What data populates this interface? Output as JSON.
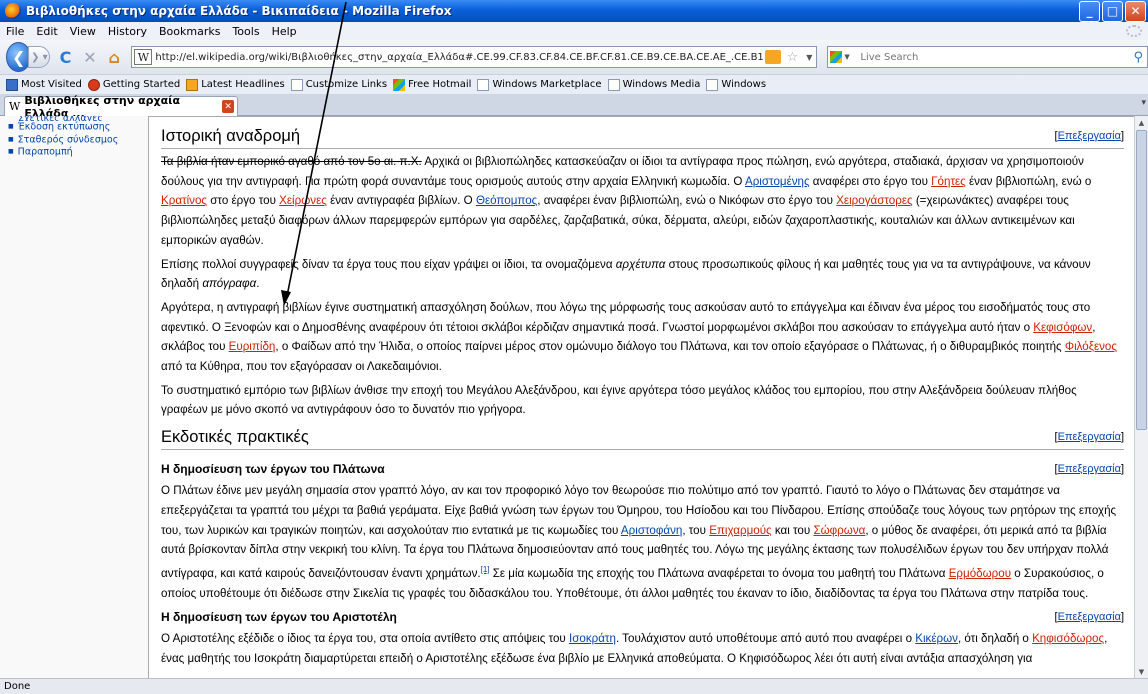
{
  "window": {
    "title": "Βιβλιοθήκες στην αρχαία Ελλάδα - Βικιπαίδεια - Mozilla Firefox",
    "minimize": "_",
    "maximize": "□",
    "close": "✕"
  },
  "menu": [
    "File",
    "Edit",
    "View",
    "History",
    "Bookmarks",
    "Tools",
    "Help"
  ],
  "nav": {
    "url": "http://el.wikipedia.org/wiki/Βιβλιοθήκες_στην_αρχαία_Ελλάδα#.CE.99.CF.83.CF.84.CE.BF.CF.81.CE.B9.CE.BA.CE.AE_.CE.B1.CE.BD.CE.B1.CE.B4.(",
    "search_placeholder": "Live Search",
    "site_icon": "W"
  },
  "bookmarks": [
    "Most Visited",
    "Getting Started",
    "Latest Headlines",
    "Customize Links",
    "Free Hotmail",
    "Windows Marketplace",
    "Windows Media",
    "Windows"
  ],
  "tab": {
    "label": "Βιβλιοθήκες στην αρχαία Ελλάδα ...",
    "icon": "W"
  },
  "sidebar": {
    "cut_item": "Σχετικές αλλαγές",
    "items": [
      "Έκδοση εκτύπωσης",
      "Σταθερός σύνδεσμος",
      "Παραπομπή"
    ]
  },
  "article": {
    "edit_label": "Επεξεργασία",
    "h_history": "Ιστορική αναδρομή",
    "h_publishing": "Εκδοτικές πρακτικές",
    "h_plato": "Η δημοσίευση των έργων του Πλάτωνα",
    "h_aristotle": "Η δημοσίευση των έργων του Αριστοτέλη",
    "p1": {
      "s0": "Τα βιβλία ήταν εμπορικό αγαθό από τον 5ο αι. π.Χ.",
      "s1": " Αρχικά οι βιβλιοπώληδες κατασκεύαζαν οι ίδιοι τα αντίγραφα προς πώληση, ενώ αργότερα, σταδιακά, άρχισαν να χρησιμοποιούν δούλους για την αντιγραφή. Για πρώτη φορά συναντάμε τους ορισμούς αυτούς στην αρχαία Ελληνική κωμωδία. Ο ",
      "l1": "Αριστομένης",
      "s2": " αναφέρει στο έργο του ",
      "l2": "Γόητες",
      "s3": " έναν βιβλιοπώλη, ενώ ο ",
      "l3": "Κρατίνος",
      "s4": " στο έργο του ",
      "l4": "Χείρωνες",
      "s5": " έναν αντιγραφέα βιβλίων. Ο ",
      "l5": "Θεόπομπος",
      "s6": ", αναφέρει έναν βιβλιοπώλη, ενώ ο Νικόφων στο έργο του ",
      "l6": "Χειρογάστορες",
      "s7": " (=χειρωνάκτες) αναφέρει τους βιβλιοπώληδες μεταξύ διαφόρων άλλων παρεμφερών εμπόρων για σαρδέλες, ζαρζαβατικά, σύκα, δέρματα, αλεύρι, ειδών ζαχαροπλαστικής, κουταλιών και άλλων αντικειμένων και εμπορικών αγαθών."
    },
    "p2": {
      "s1": "Επίσης πολλοί συγγραφείς δίναν τα έργα τους που είχαν γράψει οι ίδιοι, τα ονομαζόμενα ",
      "e1": "αρχέτυπα",
      "s2": " στους προσωπικούς φίλους ή και μαθητές τους για να τα αντιγράψουνε, να κάνουν δηλαδή ",
      "e2": "απόγραφα",
      "s3": "."
    },
    "p3": {
      "s1": "Αργότερα, η αντιγραφή βιβλίων έγινε συστηματική απασχόληση δούλων, που λόγω της μόρφωσής τους ασκούσαν αυτό το επάγγελμα και έδιναν ένα μέρος του εισοδήματός τους στο αφεντικό. Ο Ξενοφών και ο Δημοσθένης αναφέρουν ότι τέτοιοι σκλάβοι κέρδιζαν σημαντικά ποσά. Γνωστοί μορφωμένοι σκλάβοι που ασκούσαν το επάγγελμα αυτό ήταν ο ",
      "l1": "Κεφισόφων",
      "s2": ", σκλάβος του ",
      "l2": "Ευριπίδη",
      "s3": ", ο Φαίδων από την Ήλιδα, ο οποίος παίρνει μέρος στον ομώνυμο διάλογο του Πλάτωνα, και τον οποίο εξαγόρασε ο Πλάτωνας, ή ο διθυραμβικός ποιητής ",
      "l3": "Φιλόξενος",
      "s4": " από τα Κύθηρα, που τον εξαγόρασαν οι Λακεδαιμόνιοι."
    },
    "p4": "Το συστηματικό εμπόριο των βιβλίων άνθισε την εποχή του Μεγάλου Αλεξάνδρου, και έγινε αργότερα τόσο μεγάλος κλάδος του εμπορίου, που στην Αλεξάνδρεια δούλευαν πλήθος γραφέων με μόνο σκοπό να αντιγράφουν όσο το δυνατόν πιο γρήγορα.",
    "p5": {
      "s1": "Ο Πλάτων έδινε μεν μεγάλη σημασία στον γραπτό λόγο, αν και τον προφορικό λόγο τον θεωρούσε πιο πολύτιμο από τον γραπτό. Γιαυτό το λόγο ο Πλάτωνας δεν σταμάτησε να επεξεργάζεται τα γραπτά του μέχρι τα βαθιά γεράματα. Είχε βαθιά γνώση των έργων του Όμηρου, του Ησίοδου και του Πίνδαρου. Επίσης σπούδαζε τους λόγους των ρητόρων της εποχής του, των λυρικών και τραγικών ποιητών, και ασχολούταν πιο εντατικά με τις κωμωδίες του ",
      "l1": "Αριστοφάνη",
      "s2": ", του ",
      "l2": "Επιχαρμούς",
      "s3": " και του ",
      "l3": "Σώφρωνα",
      "s4": ", ο μύθος δε αναφέρει, ότι μερικά από τα βιβλία αυτά βρίσκονταν δίπλα στην νεκρική του κλίνη. Τα έργα του Πλάτωνα δημοσιεύονταν από τους μαθητές του. Λόγω της μεγάλης έκτασης των πολυσέλιδων έργων του δεν υπήρχαν πολλά αντίγραφα, και κατά καιρούς δανειζόντουσαν έναντι χρημάτων.",
      "ref": "[1]",
      "s5": " Σε μία κωμωδία της εποχής του Πλάτωνα αναφέρεται το όνομα του μαθητή του Πλάτωνα ",
      "l4": "Ερμόδωρου",
      "s6": " ο Συρακούσιος, ο οποίος υποθέτουμε ότι διέδωσε στην Σικελία τις γραφές του διδασκάλου του. Υποθέτουμε, ότι άλλοι μαθητές του έκαναν το ίδιο, διαδίδοντας τα έργα του Πλάτωνα στην πατρίδα τους."
    },
    "p6": {
      "s1": "Ο Αριστοτέλης εξέδιδε ο ίδιος τα έργα του, στα οποία αντίθετο στις απόψεις του ",
      "l1": "Ισοκράτη",
      "s2": ". Τουλάχιστον αυτό υποθέτουμε από αυτό που αναφέρει ο ",
      "l2": "Κικέρων",
      "s3": ", ότι δηλαδή ο ",
      "l3": "Κηφισόδωρος",
      "s4": ", ένας μαθητής του Ισοκράτη διαμαρτύρεται επειδή ο Αριστοτέλης εξέδωσε ένα βιβλίο με Ελληνικά αποθεύματα. Ο Κηφισόδωρος λέει ότι αυτή είναι αντάξια απασχόληση για"
    }
  },
  "status": "Done"
}
